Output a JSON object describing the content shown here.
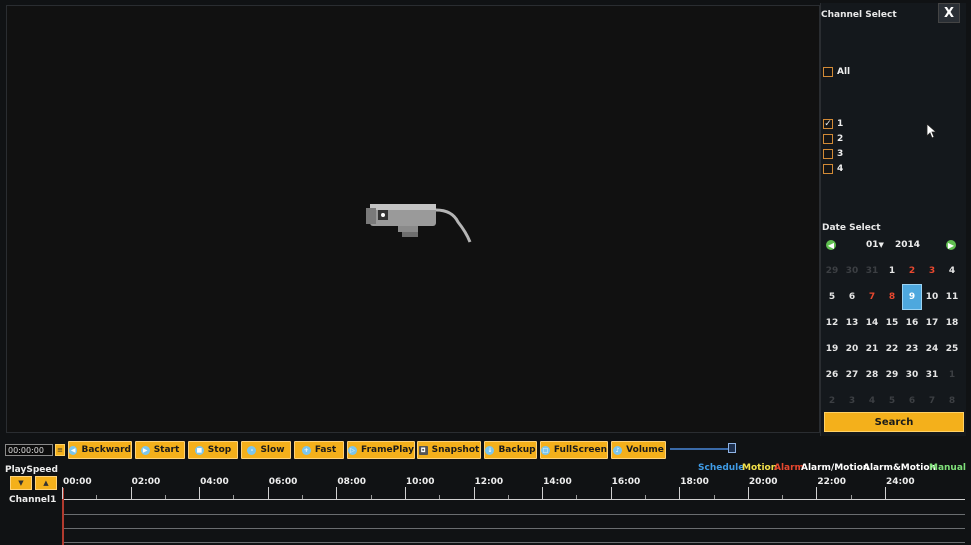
{
  "channel_panel": {
    "title": "Channel Select",
    "close_label": "X",
    "all_label": "All",
    "channels": [
      {
        "label": "1",
        "checked": true
      },
      {
        "label": "2",
        "checked": false
      },
      {
        "label": "3",
        "checked": false
      },
      {
        "label": "4",
        "checked": false
      }
    ]
  },
  "date_panel": {
    "title": "Date Select",
    "month": "01",
    "year": "2014",
    "weeks": [
      [
        {
          "d": "29",
          "s": "dim"
        },
        {
          "d": "30",
          "s": "dim"
        },
        {
          "d": "31",
          "s": "dim"
        },
        {
          "d": "1",
          "s": ""
        },
        {
          "d": "2",
          "s": "red"
        },
        {
          "d": "3",
          "s": "red"
        },
        {
          "d": "4",
          "s": ""
        }
      ],
      [
        {
          "d": "5",
          "s": ""
        },
        {
          "d": "6",
          "s": ""
        },
        {
          "d": "7",
          "s": "red"
        },
        {
          "d": "8",
          "s": "red"
        },
        {
          "d": "9",
          "s": "sel"
        },
        {
          "d": "10",
          "s": ""
        },
        {
          "d": "11",
          "s": ""
        }
      ],
      [
        {
          "d": "12",
          "s": ""
        },
        {
          "d": "13",
          "s": ""
        },
        {
          "d": "14",
          "s": ""
        },
        {
          "d": "15",
          "s": ""
        },
        {
          "d": "16",
          "s": ""
        },
        {
          "d": "17",
          "s": ""
        },
        {
          "d": "18",
          "s": ""
        }
      ],
      [
        {
          "d": "19",
          "s": ""
        },
        {
          "d": "20",
          "s": ""
        },
        {
          "d": "21",
          "s": ""
        },
        {
          "d": "22",
          "s": ""
        },
        {
          "d": "23",
          "s": ""
        },
        {
          "d": "24",
          "s": ""
        },
        {
          "d": "25",
          "s": ""
        }
      ],
      [
        {
          "d": "26",
          "s": ""
        },
        {
          "d": "27",
          "s": ""
        },
        {
          "d": "28",
          "s": ""
        },
        {
          "d": "29",
          "s": ""
        },
        {
          "d": "30",
          "s": ""
        },
        {
          "d": "31",
          "s": ""
        },
        {
          "d": "1",
          "s": "dim"
        }
      ],
      [
        {
          "d": "2",
          "s": "dim"
        },
        {
          "d": "3",
          "s": "dim"
        },
        {
          "d": "4",
          "s": "dim"
        },
        {
          "d": "5",
          "s": "dim"
        },
        {
          "d": "6",
          "s": "dim"
        },
        {
          "d": "7",
          "s": "dim"
        },
        {
          "d": "8",
          "s": "dim"
        }
      ]
    ],
    "search_label": "Search"
  },
  "controls": {
    "time": "00:00:00",
    "backward": "Backward",
    "start": "Start",
    "stop": "Stop",
    "slow": "Slow",
    "fast": "Fast",
    "frameplay": "FramePlay",
    "snapshot": "Snapshot",
    "backup": "Backup",
    "fullscreen": "FullScreen",
    "volume": "Volume",
    "volume_level": 0.95
  },
  "bottom": {
    "playspeed_label": "PlaySpeed",
    "channel_label": "Channel1",
    "legend": [
      {
        "label": "Schedule",
        "color": "#3f9be6"
      },
      {
        "label": "Motion",
        "color": "#f2e04a"
      },
      {
        "label": "Alarm",
        "color": "#e8482f"
      },
      {
        "label": "Alarm/Motion",
        "color": "#ffffff"
      },
      {
        "label": "Alarm&Motion",
        "color": "#ffffff"
      },
      {
        "label": "Manual",
        "color": "#7fe07a"
      }
    ],
    "ticks": [
      "00:00",
      "02:00",
      "04:00",
      "06:00",
      "08:00",
      "10:00",
      "12:00",
      "14:00",
      "16:00",
      "18:00",
      "20:00",
      "22:00",
      "24:00"
    ]
  }
}
